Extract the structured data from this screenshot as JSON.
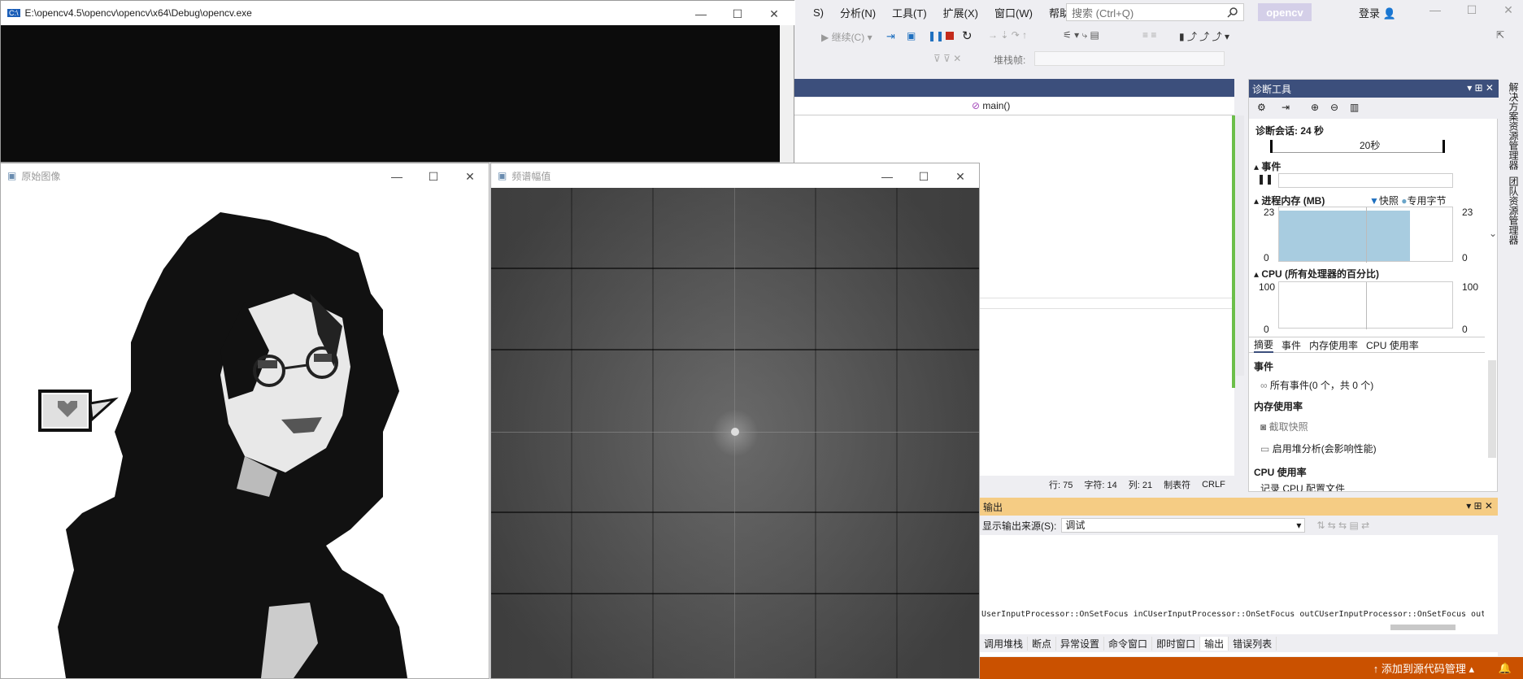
{
  "vs": {
    "menu": [
      "S)",
      "分析(N)",
      "工具(T)",
      "扩展(X)",
      "窗口(W)",
      "帮助(H)"
    ],
    "search_placeholder": "搜索 (Ctrl+Q)",
    "project": "opencv",
    "login": "登录",
    "continue_label": "继续(C)",
    "stack_frame_label": "堆栈帧:",
    "nav_function": "main()",
    "status": {
      "line": "行: 75",
      "char": "字符: 14",
      "col": "列: 21",
      "tab": "制表符",
      "eol": "CRLF"
    },
    "source_control": "添加到源代码管理"
  },
  "console": {
    "title": "E:\\opencv4.5\\opencv\\opencv\\x64\\Debug\\opencv.exe"
  },
  "original_window": {
    "title": "原始图像"
  },
  "spectrum_window": {
    "title": "频谱幅值"
  },
  "diagnostics": {
    "title": "诊断工具",
    "session": "诊断会话: 24 秒",
    "timeline_label": "20秒",
    "events_label": "事件",
    "memory_label": "进程内存 (MB)",
    "snapshot_legend": "快照",
    "private_bytes_legend": "专用字节",
    "memory_max_left": "23",
    "memory_max_right": "23",
    "memory_min_left": "0",
    "memory_min_right": "0",
    "memory_fill_fraction": 0.75,
    "cpu_label": "CPU (所有处理器的百分比)",
    "cpu_max_left": "100",
    "cpu_max_right": "100",
    "cpu_min_left": "0",
    "cpu_min_right": "0",
    "tabs": [
      "摘要",
      "事件",
      "内存使用率",
      "CPU 使用率"
    ],
    "sect_events": "事件",
    "all_events": "所有事件(0 个，共 0 个)",
    "sect_memory": "内存使用率",
    "take_snapshot": "截取快照",
    "heap_analysis": "启用堆分析(会影响性能)",
    "sect_cpu": "CPU 使用率",
    "cpu_more": "记录 CPU 配置文件"
  },
  "vertical_tabs": [
    "解决方案资源管理器",
    "团队资源管理器"
  ],
  "output": {
    "title": "输出",
    "source_label": "显示输出来源(S):",
    "source_value": "调试",
    "log_line": "UserInputProcessor::OnSetFocus inCUserInputProcessor::OnSetFocus outCUserInputProcessor::OnSetFocus out"
  },
  "bottom_tabs": [
    "调用堆栈",
    "断点",
    "异常设置",
    "命令窗口",
    "即时窗口",
    "输出",
    "错误列表"
  ],
  "colors": {
    "vs_accent": "#3c4f7c",
    "status_bar": "#ca5100",
    "output_header": "#f5cc84"
  }
}
